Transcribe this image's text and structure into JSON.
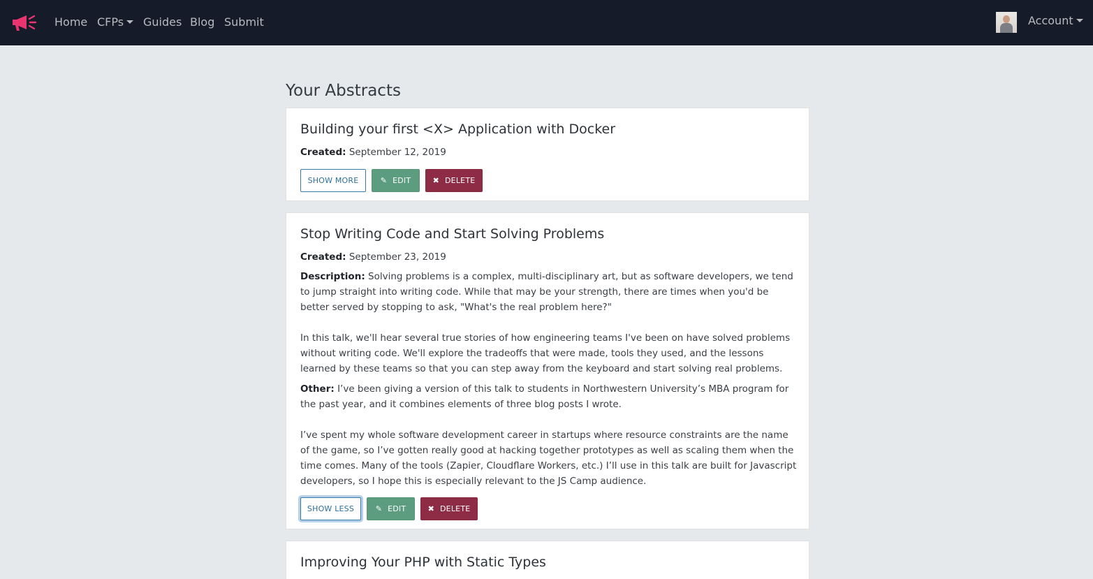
{
  "nav": {
    "logo_icon": "megaphone-icon",
    "brand_color": "#e8346f",
    "links": [
      "Home",
      "CFPs",
      "Guides",
      "Blog",
      "Submit"
    ],
    "account_label": "Account"
  },
  "page": {
    "title": "Your Abstracts"
  },
  "abstracts": [
    {
      "title": "Building your first <X> Application with Docker",
      "created_label": "Created:",
      "created": "September 12, 2019",
      "toggle_label": "SHOW MORE",
      "edit_label": "EDIT",
      "delete_label": "DELETE"
    },
    {
      "title": "Stop Writing Code and Start Solving Problems",
      "created_label": "Created:",
      "created": "September 23, 2019",
      "description_label": "Description:",
      "description_p1": "Solving problems is a complex, multi-disciplinary art, but as software developers, we tend to jump straight into writing code. While that may be your strength, there are times when you'd be better served by stopping to ask, \"What's the real problem here?\"",
      "description_p2": "In this talk, we'll hear several true stories of how engineering teams I've been on have solved problems without writing code. We'll explore the tradeoffs that were made, tools they used, and the lessons learned by these teams so that you can step away from the keyboard and start solving real problems.",
      "other_label": "Other:",
      "other_p1": "I’ve been giving a version of this talk to students in Northwestern University’s MBA program for the past year, and it combines elements of three blog posts I wrote.",
      "other_p2": "I’ve spent my whole software development career in startups where resource constraints are the name of the game, so I’ve gotten really good at hacking together prototypes as well as scaling them when the time comes. Many of the tools (Zapier, Cloudflare Workers, etc.) I’ll use in this talk are built for Javascript developers, so I hope this is especially relevant to the JS Camp audience.",
      "toggle_label": "SHOW LESS",
      "edit_label": "EDIT",
      "delete_label": "DELETE"
    },
    {
      "title": "Improving Your PHP with Static Types"
    }
  ],
  "colors": {
    "navbar_bg": "#151b29",
    "page_bg": "#e6e9ec",
    "edit_button": "#5c9c7f",
    "delete_button": "#8e2c46",
    "outline_button": "#3a7ca8"
  }
}
